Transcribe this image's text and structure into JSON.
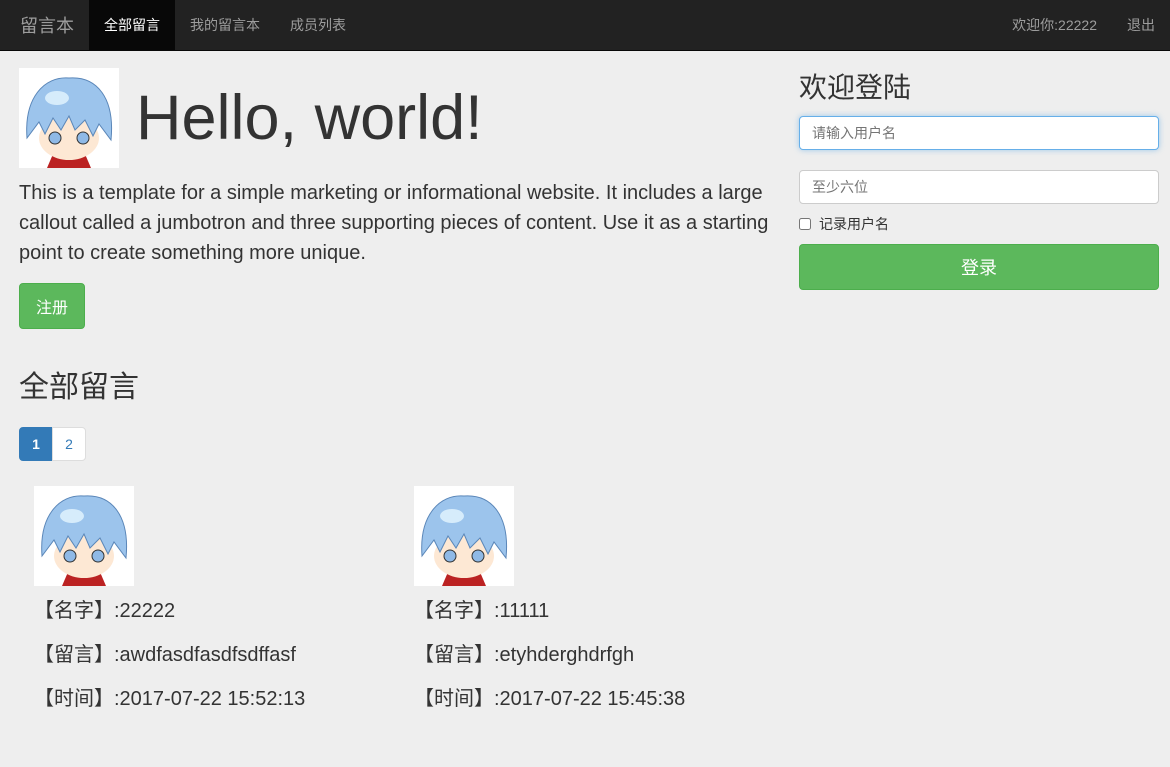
{
  "nav": {
    "brand": "留言本",
    "items": [
      {
        "label": "全部留言",
        "active": true
      },
      {
        "label": "我的留言本"
      },
      {
        "label": "成员列表"
      }
    ],
    "welcome": "欢迎你:22222",
    "logout": "退出"
  },
  "jumbotron": {
    "title": "Hello, world!",
    "text": "This is a template for a simple marketing or informational website. It includes a large callout called a jumbotron and three supporting pieces of content. Use it as a starting point to create something more unique.",
    "register": "注册"
  },
  "login": {
    "title": "欢迎登陆",
    "username_placeholder": "请输入用户名",
    "password_placeholder": "至少六位",
    "remember": "记录用户名",
    "submit": "登录"
  },
  "section_title": "全部留言",
  "pagination": [
    "1",
    "2"
  ],
  "messages": [
    {
      "name": "【名字】:22222",
      "message": "【留言】:awdfasdfasdfsdffasf",
      "time": "【时间】:2017-07-22 15:52:13"
    },
    {
      "name": "【名字】:11111",
      "message": "【留言】:etyhderghdrfgh",
      "time": "【时间】:2017-07-22 15:45:38"
    }
  ],
  "colors": {
    "navbar": "#222222",
    "success": "#5cb85c",
    "primary": "#337ab7"
  }
}
